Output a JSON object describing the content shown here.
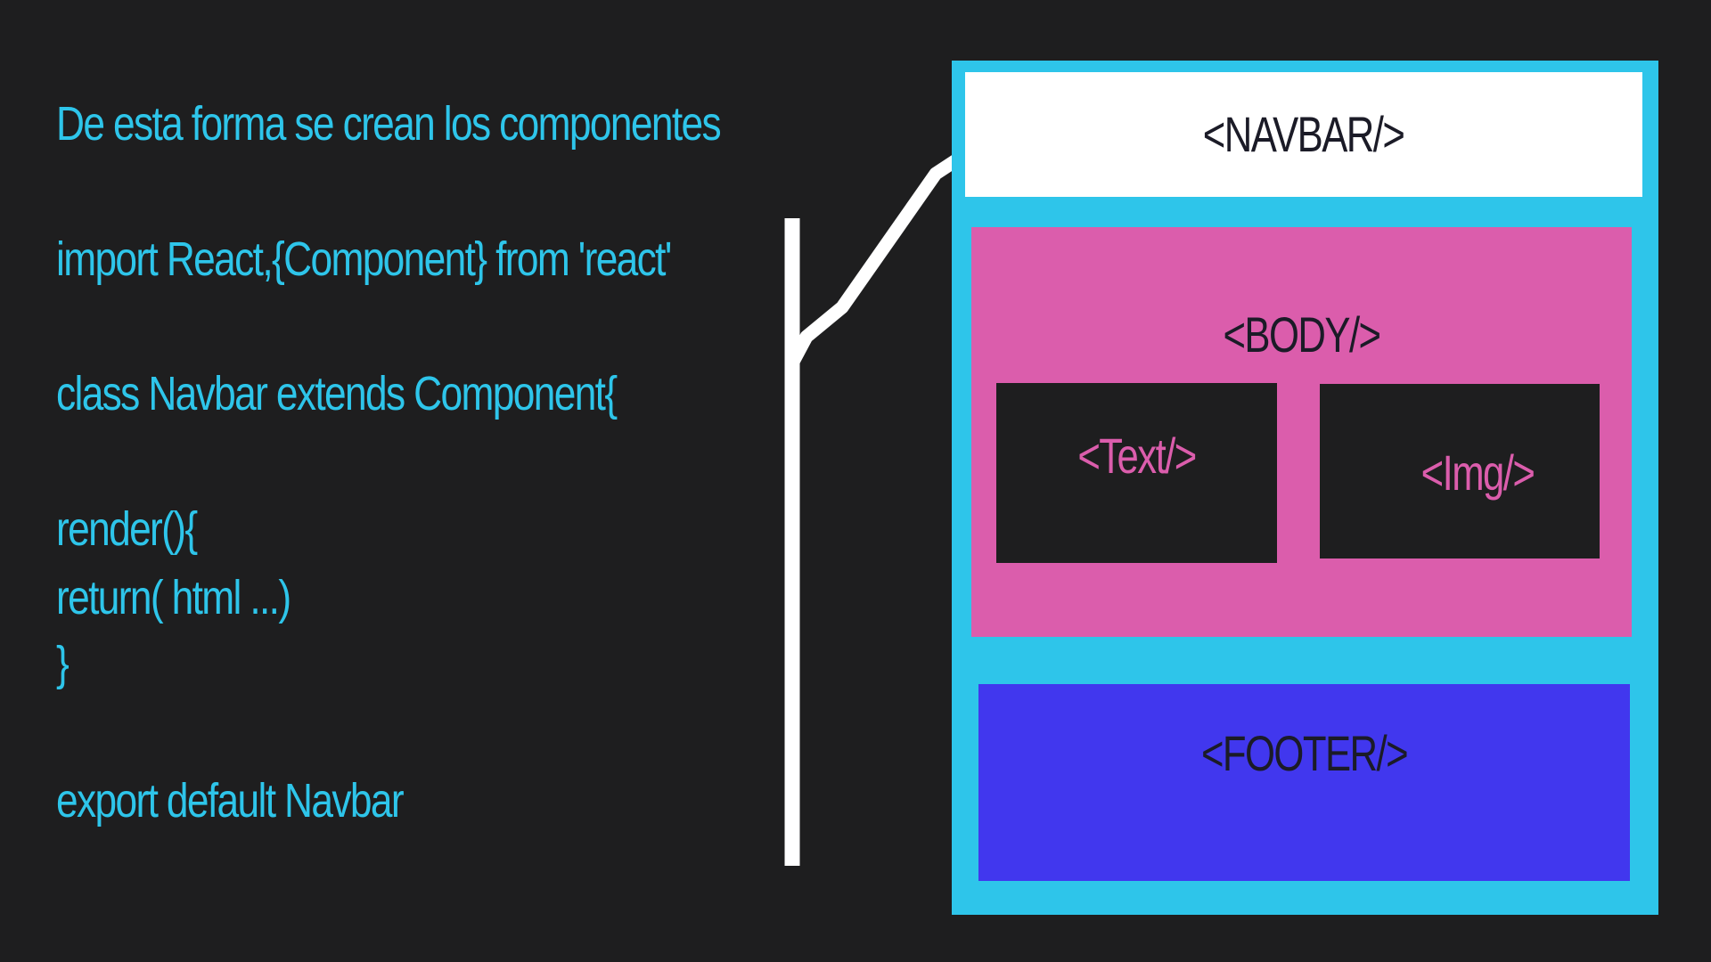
{
  "code": {
    "heading": "De esta forma se crean los componentes",
    "import_line": "import React,{Component} from 'react'",
    "class_line": "class Navbar extends Component{",
    "render_line": "render(){",
    "return_line": "return( html ...)",
    "close_brace": "}",
    "export_line": "export default Navbar"
  },
  "diagram": {
    "navbar": "<NAVBAR/>",
    "body": "<BODY/>",
    "text": "<Text/>",
    "img": "<Img/>",
    "footer": "<FOOTER/>"
  },
  "colors": {
    "background": "#1e1e1f",
    "code_text": "#2ec5ea",
    "frame": "#2ec5ea",
    "navbar": "#ffffff",
    "body": "#db5dac",
    "inner_box": "#1e1e1f",
    "footer": "#4137ee",
    "connector": "#ffffff"
  }
}
